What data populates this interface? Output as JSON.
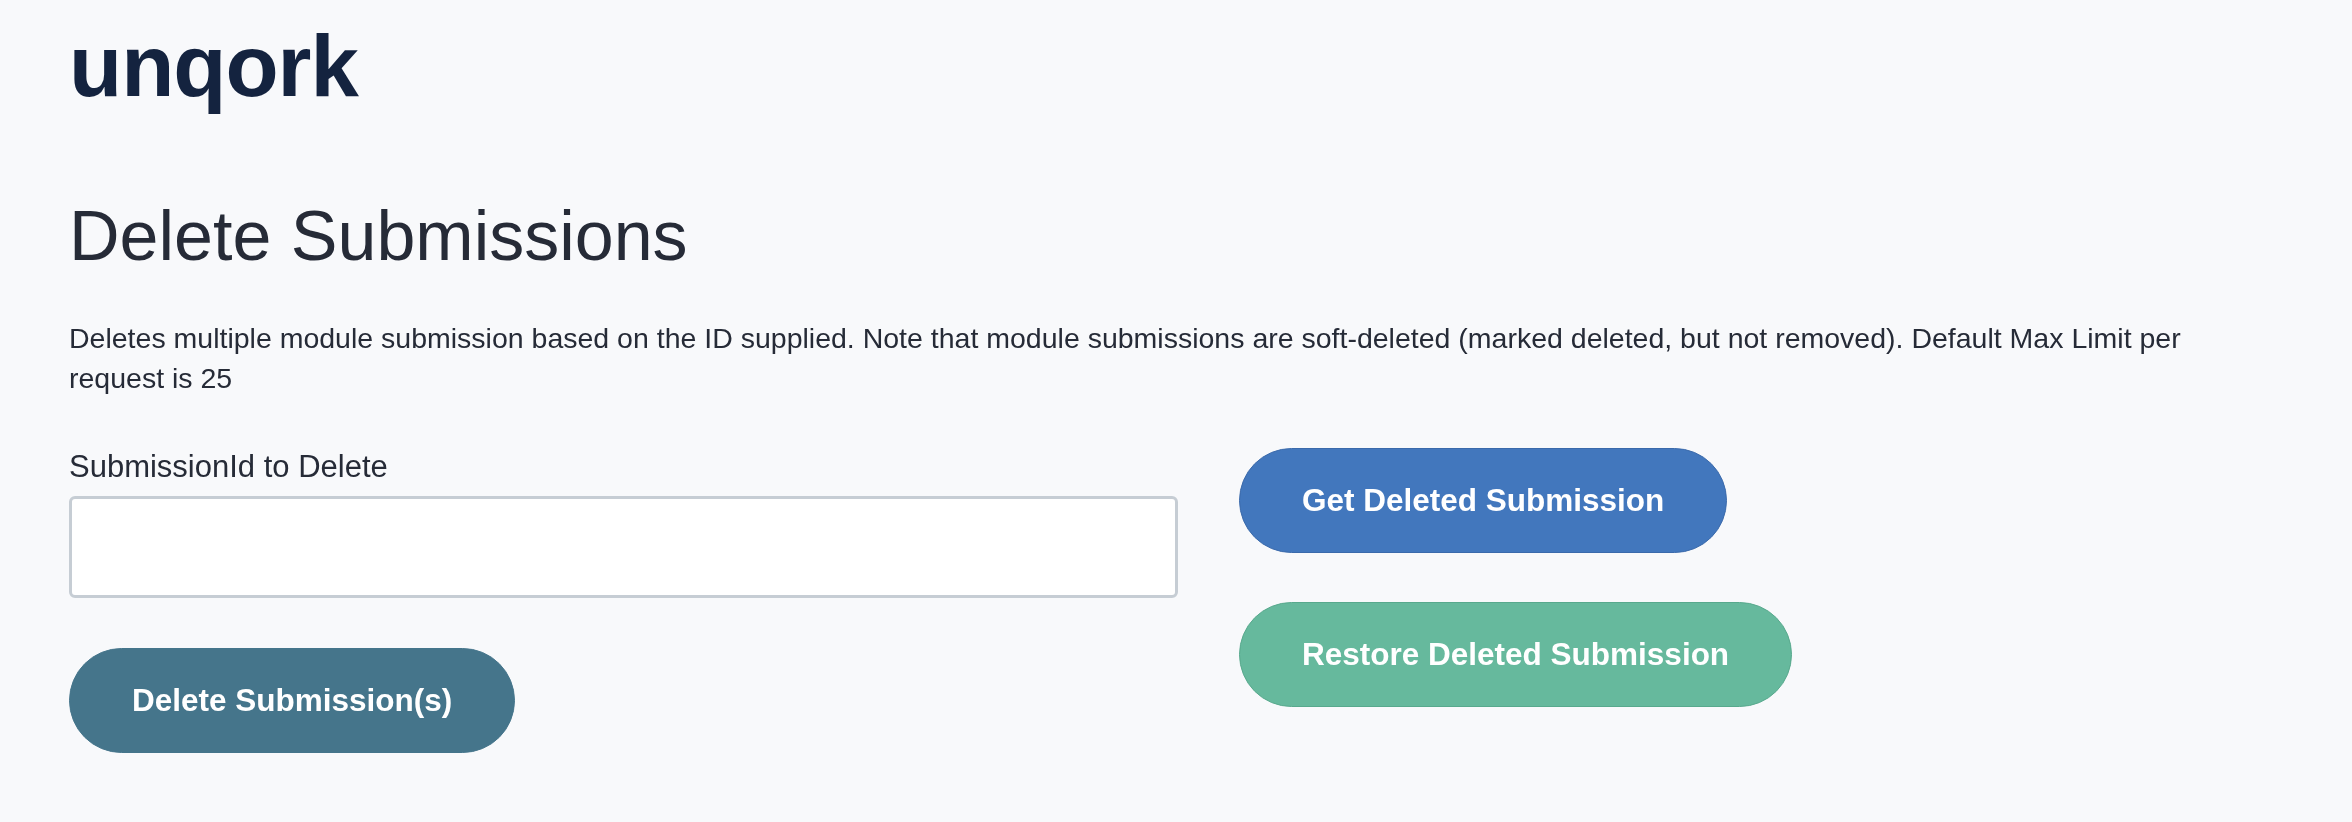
{
  "logo": {
    "text": "unqork"
  },
  "page": {
    "title": "Delete Submissions",
    "description": "Deletes multiple module submission based on the ID supplied. Note that module submissions are soft-deleted (marked deleted, but not removed). Default Max Limit per request is 25"
  },
  "form": {
    "field": {
      "label": "SubmissionId to Delete"
    },
    "submit": {
      "label": "Delete Submission(s)",
      "kind": "secondary"
    }
  },
  "actions": [
    {
      "label": "Get Deleted Submission",
      "kind": "primary"
    },
    {
      "label": "Restore Deleted Submission",
      "kind": "success"
    }
  ]
}
